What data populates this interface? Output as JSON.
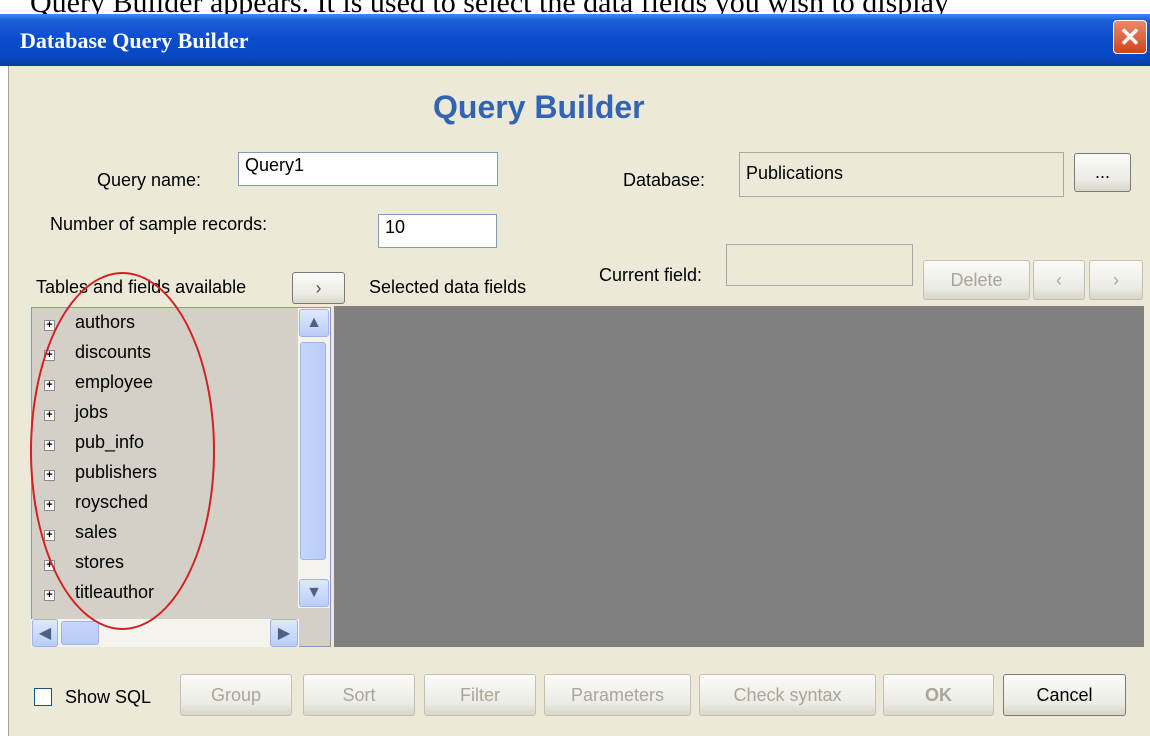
{
  "header_fragment": "Query Builder appears.  It is used to select the data fields you wish to display",
  "window": {
    "title": "Database Query Builder",
    "close_label": "✕"
  },
  "heading": "Query Builder",
  "query_name": {
    "label": "Query name:",
    "value": "Query1"
  },
  "database": {
    "label": "Database:",
    "value": "Publications",
    "browse_label": "..."
  },
  "sample_records": {
    "label": "Number of sample records:",
    "value": "10"
  },
  "current_field": {
    "label": "Current field:",
    "value": ""
  },
  "tables_panel": {
    "label": "Tables and fields available",
    "add_button": "›",
    "items": [
      "authors",
      "discounts",
      "employee",
      "jobs",
      "pub_info",
      "publishers",
      "roysched",
      "sales",
      "stores",
      "titleauthor"
    ]
  },
  "selected_panel": {
    "label": "Selected data fields"
  },
  "field_buttons": {
    "delete": "Delete",
    "left": "‹",
    "right": "›"
  },
  "scrollbar": {
    "up": "▲",
    "down": "▼",
    "left": "◀",
    "right": "▶"
  },
  "bottom": {
    "show_sql": "Show SQL",
    "buttons": [
      "Group",
      "Sort",
      "Filter",
      "Parameters",
      "Check syntax",
      "OK",
      "Cancel"
    ]
  },
  "colors": {
    "titlebar": "#0a4ccc",
    "heading": "#3264b4",
    "panel": "#808080",
    "annotation": "#d42020"
  }
}
